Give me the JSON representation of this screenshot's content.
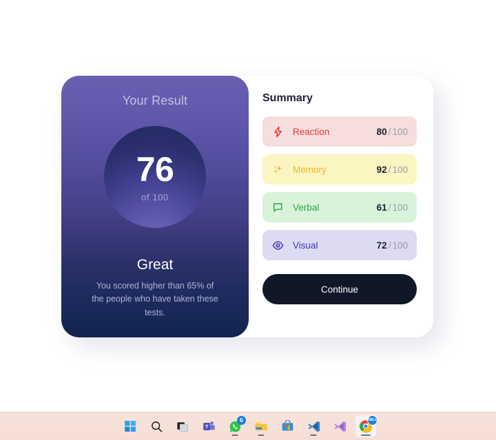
{
  "result": {
    "title": "Your Result",
    "score": "76",
    "out_of": "of 100",
    "rank": "Great",
    "description": "You scored higher than 65% of the people who have taken these tests."
  },
  "summary": {
    "title": "Summary",
    "rows": [
      {
        "icon": "lightning-bolt-icon",
        "label": "Reaction",
        "score": "80",
        "separator": "/",
        "total": "100",
        "accent": "#e33b3b",
        "background": "#f6dede"
      },
      {
        "icon": "sparkles-icon",
        "label": "Memory",
        "score": "92",
        "separator": "/",
        "total": "100",
        "accent": "#efb52a",
        "background": "#fbf5c1"
      },
      {
        "icon": "speech-bubble-icon",
        "label": "Verbal",
        "score": "61",
        "separator": "/",
        "total": "100",
        "accent": "#27a845",
        "background": "#d8f3da"
      },
      {
        "icon": "eye-icon",
        "label": "Visual",
        "score": "72",
        "separator": "/",
        "total": "100",
        "accent": "#3a34b6",
        "background": "#dddbf1"
      }
    ],
    "continue_label": "Continue"
  },
  "taskbar": {
    "items": [
      {
        "name": "start-button",
        "label": "Start"
      },
      {
        "name": "search-button",
        "label": "Search"
      },
      {
        "name": "task-view-button",
        "label": "Task View"
      },
      {
        "name": "microsoft-teams-button",
        "label": "Microsoft Teams"
      },
      {
        "name": "whatsapp-button",
        "label": "WhatsApp",
        "badge": "6"
      },
      {
        "name": "file-explorer-button",
        "label": "File Explorer"
      },
      {
        "name": "microsoft-store-button",
        "label": "Microsoft Store"
      },
      {
        "name": "vs-code-button",
        "label": "Visual Studio Code"
      },
      {
        "name": "visual-studio-button",
        "label": "Visual Studio"
      },
      {
        "name": "google-chrome-button",
        "label": "Google Chrome",
        "badge": "DELL"
      }
    ]
  }
}
